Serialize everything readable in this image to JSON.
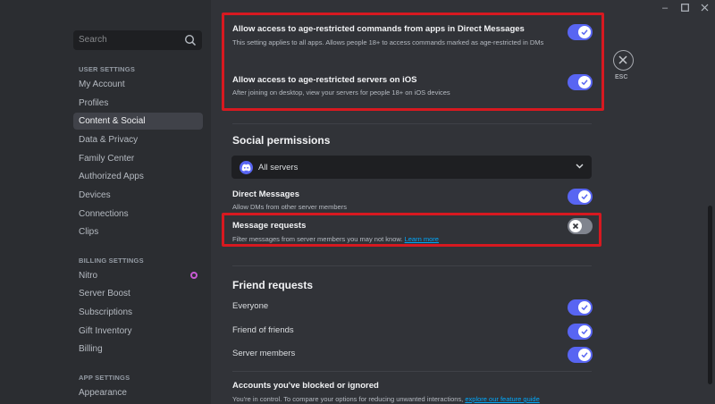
{
  "search": {
    "placeholder": "Search"
  },
  "sidebar": {
    "user_settings_header": "USER SETTINGS",
    "user_items": [
      {
        "label": "My Account"
      },
      {
        "label": "Profiles"
      },
      {
        "label": "Content & Social",
        "active": true
      },
      {
        "label": "Data & Privacy"
      },
      {
        "label": "Family Center"
      },
      {
        "label": "Authorized Apps"
      },
      {
        "label": "Devices"
      },
      {
        "label": "Connections"
      },
      {
        "label": "Clips"
      }
    ],
    "billing_settings_header": "BILLING SETTINGS",
    "billing_items": [
      {
        "label": "Nitro"
      },
      {
        "label": "Server Boost"
      },
      {
        "label": "Subscriptions"
      },
      {
        "label": "Gift Inventory"
      },
      {
        "label": "Billing"
      }
    ],
    "app_settings_header": "APP SETTINGS",
    "app_items": [
      {
        "label": "Appearance"
      }
    ]
  },
  "esc": {
    "label": "ESC"
  },
  "age_restricted": {
    "dm_commands": {
      "title": "Allow access to age-restricted commands from apps in Direct Messages",
      "desc": "This setting applies to all apps. Allows people 18+ to access commands marked as age-restricted in DMs",
      "enabled": true
    },
    "ios_servers": {
      "title": "Allow access to age-restricted servers on iOS",
      "desc": "After joining on desktop, view your servers for people 18+ on iOS devices",
      "enabled": true
    }
  },
  "social_permissions": {
    "title": "Social permissions",
    "select_value": "All servers",
    "direct_messages": {
      "title": "Direct Messages",
      "desc": "Allow DMs from other server members",
      "enabled": true
    },
    "message_requests": {
      "title": "Message requests",
      "desc": "Filter messages from server members you may not know.",
      "link": "Learn more",
      "enabled": false
    }
  },
  "friend_requests": {
    "title": "Friend requests",
    "everyone": {
      "label": "Everyone",
      "enabled": true
    },
    "friends_of_friends": {
      "label": "Friend of friends",
      "enabled": true
    },
    "server_members": {
      "label": "Server members",
      "enabled": true
    }
  },
  "blocked": {
    "title": "Accounts you've blocked or ignored",
    "desc": "You're in control. To compare your options for reducing unwanted interactions,",
    "link": "explore our feature guide"
  },
  "colors": {
    "accent": "#5865f2",
    "highlight": "#d71920",
    "link": "#00a8fc"
  }
}
